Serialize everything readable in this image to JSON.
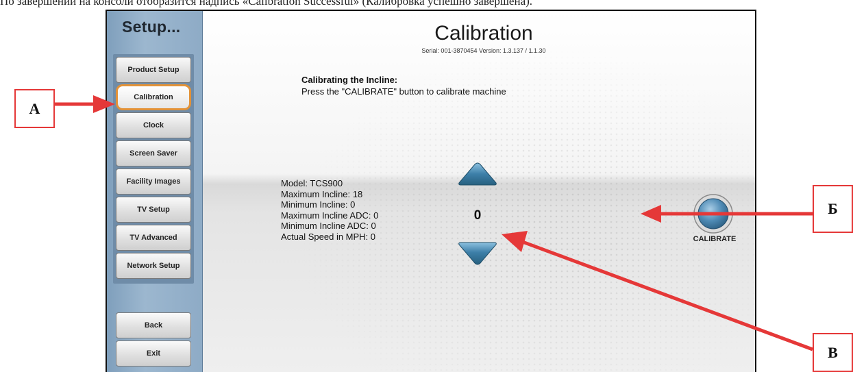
{
  "caption": "По завершении на консоли отобразится надпись «Calibration Successful» (Калибровка успешно завершена).",
  "sidebar": {
    "title": "Setup...",
    "items": [
      {
        "label": "Product Setup"
      },
      {
        "label": "Calibration"
      },
      {
        "label": "Clock"
      },
      {
        "label": "Screen Saver"
      },
      {
        "label": "Facility Images"
      },
      {
        "label": "TV Setup"
      },
      {
        "label": "TV Advanced"
      },
      {
        "label": "Network Setup"
      }
    ],
    "active_item": "Calibration",
    "back_label": "Back",
    "exit_label": "Exit"
  },
  "main": {
    "title": "Calibration",
    "serial_line": "Serial: 001-3870454   Version: 1.3.137 / 1.1.30",
    "instruction_heading": "Calibrating the Incline:",
    "instruction_text": "Press the \"CALIBRATE\" button to calibrate machine",
    "info": [
      "Model: TCS900",
      "Maximum Incline: 18",
      "Minimum Incline: 0",
      "Maximum Incline ADC: 0",
      "Minimum Incline ADC: 0",
      "Actual Speed in MPH: 0"
    ],
    "incline_value": "0",
    "up_icon": "triangle-up-icon",
    "down_icon": "triangle-down-icon",
    "calibrate_label": "CALIBRATE"
  },
  "annotations": {
    "label_a": "A",
    "label_b": "Б",
    "label_v": "В",
    "color": "#e53838"
  },
  "colors": {
    "sidebar": "#8eabc6",
    "active_outline": "#e39237",
    "arrow_blue": "#3d7fa8"
  }
}
